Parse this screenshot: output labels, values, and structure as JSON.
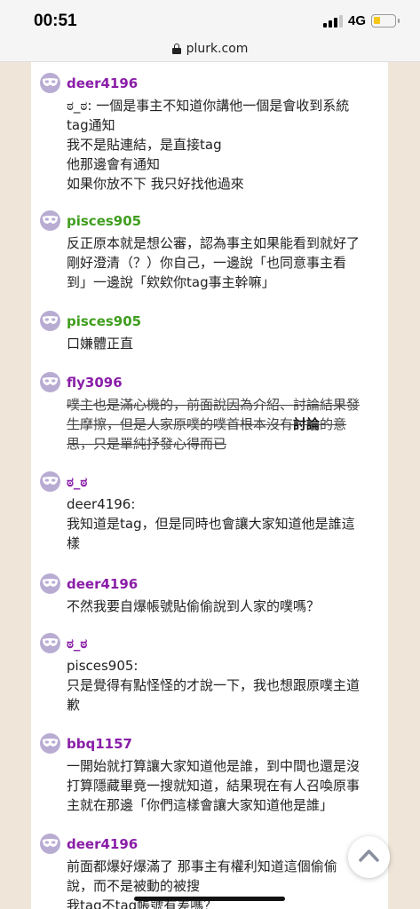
{
  "status_bar": {
    "time": "00:51",
    "network": "4G"
  },
  "browser": {
    "url": "plurk.com"
  },
  "responses": [
    {
      "user": "deer4196",
      "lines": [
        "ಠ_ಠ: 一個是事主不知道你講他一個是會收到系統",
        "tag通知",
        "我不是貼連結，是直接tag",
        "他那邊會有通知",
        "如果你放不下 我只好找他過來"
      ]
    },
    {
      "user": "pisces905",
      "lines": [
        "反正原本就是想公審，認為事主如果能看到就好了",
        "剛好澄清（？）你自己，一邊說「也同意事主看",
        "到」一邊說「欸欸你tag事主幹嘛」"
      ]
    },
    {
      "user": "pisces905",
      "lines": [
        "口嫌體正直"
      ]
    },
    {
      "user": "fly3096",
      "struck": [
        "噗主也是滿心機的，前面說因為介紹、討論結果發",
        "生摩擦，但是人家原噗的噗首根本沒有",
        "的意",
        "思，只是單純抒發心得而已"
      ],
      "bold": "討論"
    },
    {
      "user": "ಠ_ಠ",
      "lines": [
        "deer4196:",
        "我知道是tag，但是同時也會讓大家知道他是誰這",
        "樣"
      ]
    },
    {
      "user": "deer4196",
      "lines": [
        "不然我要自爆帳號貼偷偷說到人家的噗嗎？"
      ]
    },
    {
      "user": "ಠ_ಠ",
      "lines": [
        "pisces905:",
        "只是覺得有點怪怪的才說一下，我也想跟原噗主道",
        "歉"
      ]
    },
    {
      "user": "bbq1157",
      "lines": [
        "一開始就打算讓大家知道他是誰，到中間也還是沒",
        "打算隱藏畢竟一搜就知道，結果現在有人召喚原事",
        "主就在那邊「你們這樣會讓大家知道他是誰」"
      ]
    },
    {
      "user": "deer4196",
      "lines": [
        "前面都爆好爆滿了 那事主有權利知道這個偷偷",
        "說，而不是被動的被搜",
        "我tag不tag帳號有差嗎？"
      ]
    }
  ],
  "icons": {
    "avatar": "anonymous-mask-icon",
    "scroll_top": "chevron-up-icon",
    "lock": "lock-icon"
  },
  "colors": {
    "user_default": "#8a1ea8",
    "user_green": "#3f9e1e",
    "avatar_bg": "#b9acd3",
    "page_bg": "#efe5d9"
  }
}
